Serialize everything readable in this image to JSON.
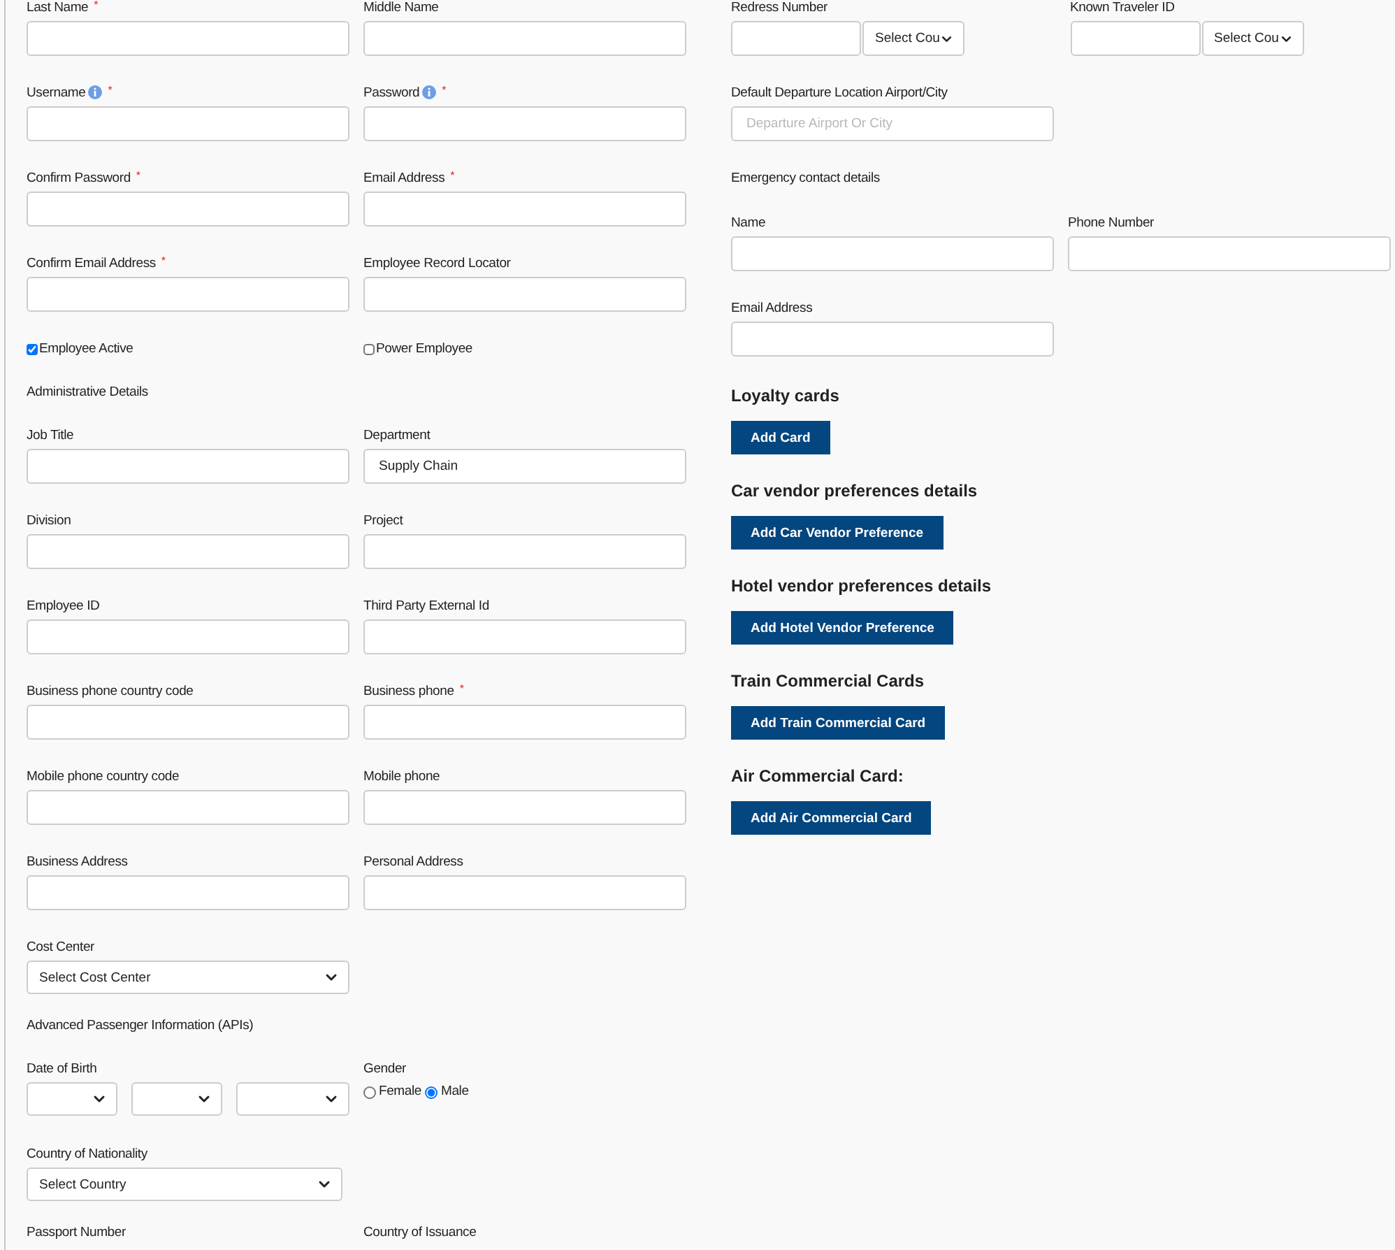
{
  "left": [
    {
      "kind": "fields",
      "fields": [
        {
          "kind": "text",
          "label": "Last Name",
          "mark": "*"
        },
        {
          "kind": "text",
          "label": "Middle Name"
        }
      ]
    },
    {
      "kind": "fields",
      "fields": [
        {
          "kind": "text",
          "label": "Username",
          "info": true,
          "mark": "*"
        },
        {
          "kind": "text",
          "label": "Password",
          "info": true,
          "mark": "*"
        }
      ]
    },
    {
      "kind": "fields",
      "fields": [
        {
          "kind": "text",
          "label": "Confirm Password",
          "mark": "*"
        },
        {
          "kind": "text",
          "label": "Email Address",
          "mark": "*"
        }
      ]
    },
    {
      "kind": "fields",
      "fields": [
        {
          "kind": "text",
          "label": "Confirm Email Address",
          "mark": "*"
        },
        {
          "kind": "text",
          "label": "Employee Record Locator"
        }
      ]
    },
    {
      "kind": "fields",
      "fields": [
        {
          "kind": "checkbox",
          "label": "Employee Active",
          "checked": true
        },
        {
          "kind": "checkbox",
          "label": "Power Employee",
          "checked": false
        }
      ]
    },
    {
      "kind": "heading",
      "text": "Administrative Details"
    },
    {
      "kind": "fields",
      "fields": [
        {
          "kind": "text",
          "label": "Job Title"
        },
        {
          "kind": "text",
          "label": "Department",
          "value": "Supply Chain"
        }
      ]
    },
    {
      "kind": "fields",
      "fields": [
        {
          "kind": "text",
          "label": "Division"
        },
        {
          "kind": "text",
          "label": "Project"
        }
      ]
    },
    {
      "kind": "fields",
      "fields": [
        {
          "kind": "text",
          "label": "Employee ID"
        },
        {
          "kind": "text",
          "label": "Third Party External Id"
        }
      ]
    },
    {
      "kind": "fields",
      "fields": [
        {
          "kind": "text",
          "label": "Business phone country code"
        },
        {
          "kind": "text",
          "label": "Business phone",
          "mark": "*"
        }
      ]
    },
    {
      "kind": "fields",
      "fields": [
        {
          "kind": "text",
          "label": "Mobile phone country code"
        },
        {
          "kind": "text",
          "label": "Mobile phone"
        }
      ]
    },
    {
      "kind": "fields",
      "fields": [
        {
          "kind": "text",
          "label": "Business Address"
        },
        {
          "kind": "text",
          "label": "Personal Address"
        }
      ]
    },
    {
      "kind": "fields",
      "fields": [
        {
          "kind": "select",
          "label": "Cost Center",
          "value": "Select Cost Center"
        }
      ]
    },
    {
      "kind": "heading",
      "text": "Advanced Passenger Information (APIs)"
    },
    {
      "kind": "fields",
      "fields": [
        {
          "kind": "date",
          "label": "Date of Birth"
        },
        {
          "kind": "radio",
          "label": "Gender",
          "options": [
            {
              "label": "Female",
              "selected": false
            },
            {
              "label": "Male",
              "selected": true
            }
          ]
        }
      ]
    },
    {
      "kind": "fields",
      "fields": [
        {
          "kind": "select",
          "label": "Country of Nationality",
          "value": "Select Country",
          "narrow": true
        }
      ]
    },
    {
      "kind": "fields",
      "fields": [
        {
          "kind": "label",
          "label": "Passport Number"
        },
        {
          "kind": "label",
          "label": "Country of Issuance"
        }
      ]
    }
  ],
  "right": [
    {
      "kind": "fields",
      "fields": [
        {
          "kind": "split",
          "label": "Redress Number",
          "select": "Select Cou"
        },
        {
          "kind": "split",
          "label": "Known Traveler ID",
          "select": "Select Cou"
        }
      ]
    },
    {
      "kind": "fields",
      "fields": [
        {
          "kind": "text",
          "label": "Default Departure Location Airport/City",
          "placeholder": "Departure Airport Or City"
        }
      ]
    },
    {
      "kind": "heading",
      "text": "Emergency contact details"
    },
    {
      "kind": "fields",
      "fields": [
        {
          "kind": "text",
          "label": "Name"
        },
        {
          "kind": "text",
          "label": "Phone Number"
        }
      ]
    },
    {
      "kind": "fields",
      "fields": [
        {
          "kind": "text",
          "label": "Email Address"
        }
      ]
    },
    {
      "kind": "section",
      "title": "Loyalty cards",
      "button": "Add Card"
    },
    {
      "kind": "section",
      "title": "Car vendor preferences details",
      "button": "Add Car Vendor Preference"
    },
    {
      "kind": "section",
      "title": "Hotel vendor preferences details",
      "button": "Add Hotel Vendor Preference"
    },
    {
      "kind": "section",
      "title": "Train Commercial Cards",
      "button": "Add Train Commercial Card"
    },
    {
      "kind": "section",
      "title": "Air Commercial Card:",
      "button": "Add Air Commercial Card"
    }
  ]
}
